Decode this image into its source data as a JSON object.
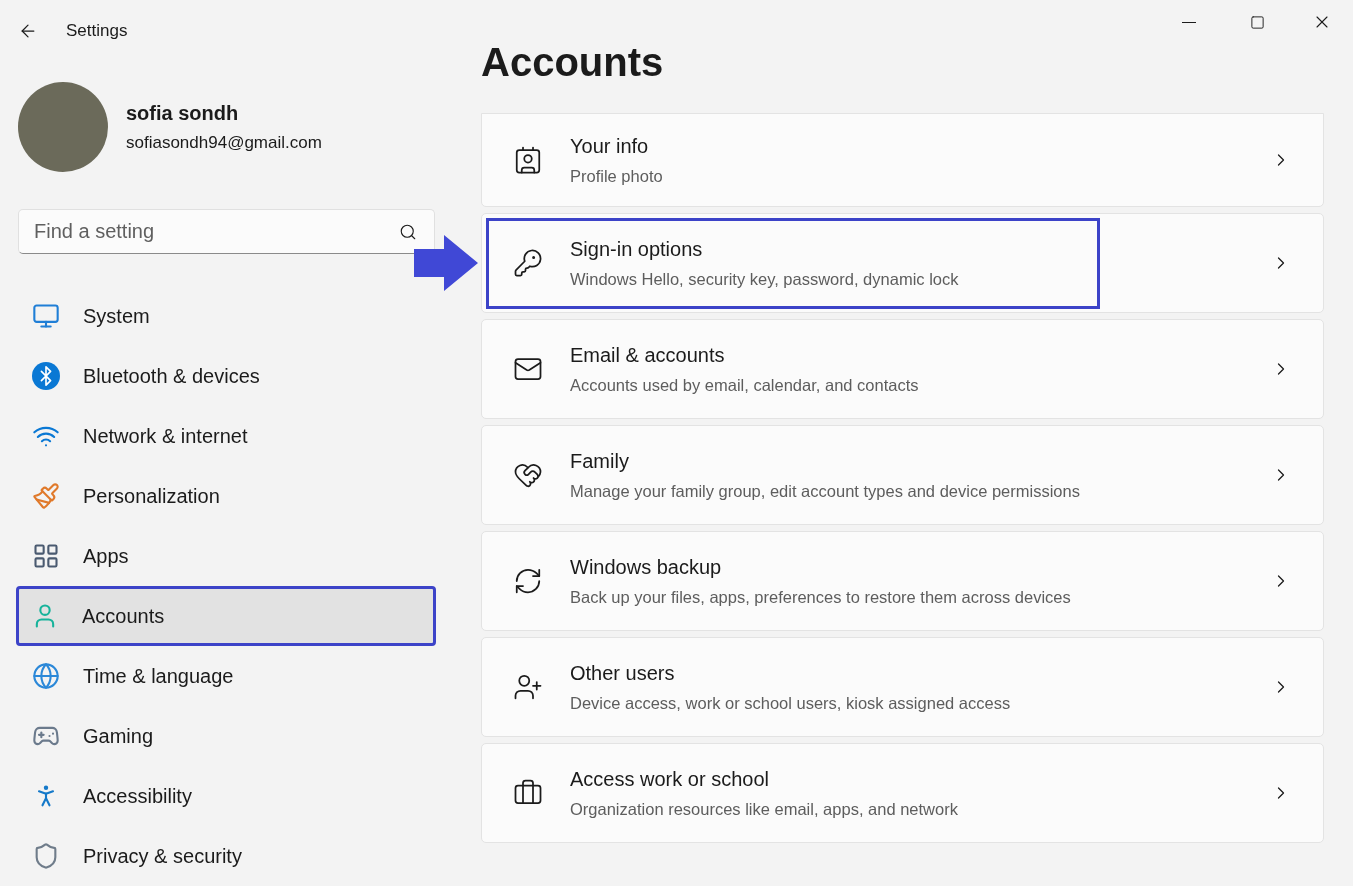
{
  "window": {
    "title": "Settings"
  },
  "user": {
    "name": "sofia sondh",
    "email": "sofiasondh94@gmail.com"
  },
  "search": {
    "placeholder": "Find a setting"
  },
  "nav": [
    {
      "label": "System",
      "selected": false,
      "highlighted": false
    },
    {
      "label": "Bluetooth & devices",
      "selected": false,
      "highlighted": false
    },
    {
      "label": "Network & internet",
      "selected": false,
      "highlighted": false
    },
    {
      "label": "Personalization",
      "selected": false,
      "highlighted": false
    },
    {
      "label": "Apps",
      "selected": false,
      "highlighted": false
    },
    {
      "label": "Accounts",
      "selected": true,
      "highlighted": true
    },
    {
      "label": "Time & language",
      "selected": false,
      "highlighted": false
    },
    {
      "label": "Gaming",
      "selected": false,
      "highlighted": false
    },
    {
      "label": "Accessibility",
      "selected": false,
      "highlighted": false
    },
    {
      "label": "Privacy & security",
      "selected": false,
      "highlighted": false
    }
  ],
  "page": {
    "title": "Accounts"
  },
  "items": [
    {
      "title": "Your info",
      "subtitle": "Profile photo",
      "highlighted": false
    },
    {
      "title": "Sign-in options",
      "subtitle": "Windows Hello, security key, password, dynamic lock",
      "highlighted": true
    },
    {
      "title": "Email & accounts",
      "subtitle": "Accounts used by email, calendar, and contacts",
      "highlighted": false
    },
    {
      "title": "Family",
      "subtitle": "Manage your family group, edit account types and device permissions",
      "highlighted": false
    },
    {
      "title": "Windows backup",
      "subtitle": "Back up your files, apps, preferences to restore them across devices",
      "highlighted": false
    },
    {
      "title": "Other users",
      "subtitle": "Device access, work or school users, kiosk assigned access",
      "highlighted": false
    },
    {
      "title": "Access work or school",
      "subtitle": "Organization resources like email, apps, and network",
      "highlighted": false
    }
  ]
}
